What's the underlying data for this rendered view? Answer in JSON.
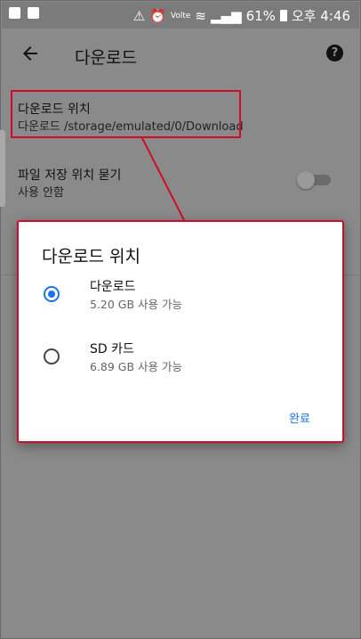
{
  "status_bar": {
    "battery": "61%",
    "network": "Volte",
    "time": "오후 4:46"
  },
  "app_bar": {
    "title": "다운로드"
  },
  "settings": {
    "download_location": {
      "title": "다운로드 위치",
      "value": "다운로드 /storage/emulated/0/Download"
    },
    "ask_location": {
      "title": "파일 저장 위치 묻기",
      "value": "사용 안함",
      "enabled": false
    }
  },
  "dialog": {
    "title": "다운로드 위치",
    "options": [
      {
        "label": "다운로드",
        "sub": "5.20 GB 사용 가능",
        "selected": true
      },
      {
        "label": "SD 카드",
        "sub": "6.89 GB 사용 가능",
        "selected": false
      }
    ],
    "done_label": "완료"
  },
  "colors": {
    "accent": "#1a73e8",
    "annotation": "#d10c2a",
    "scrim": "#8a8a8a"
  }
}
